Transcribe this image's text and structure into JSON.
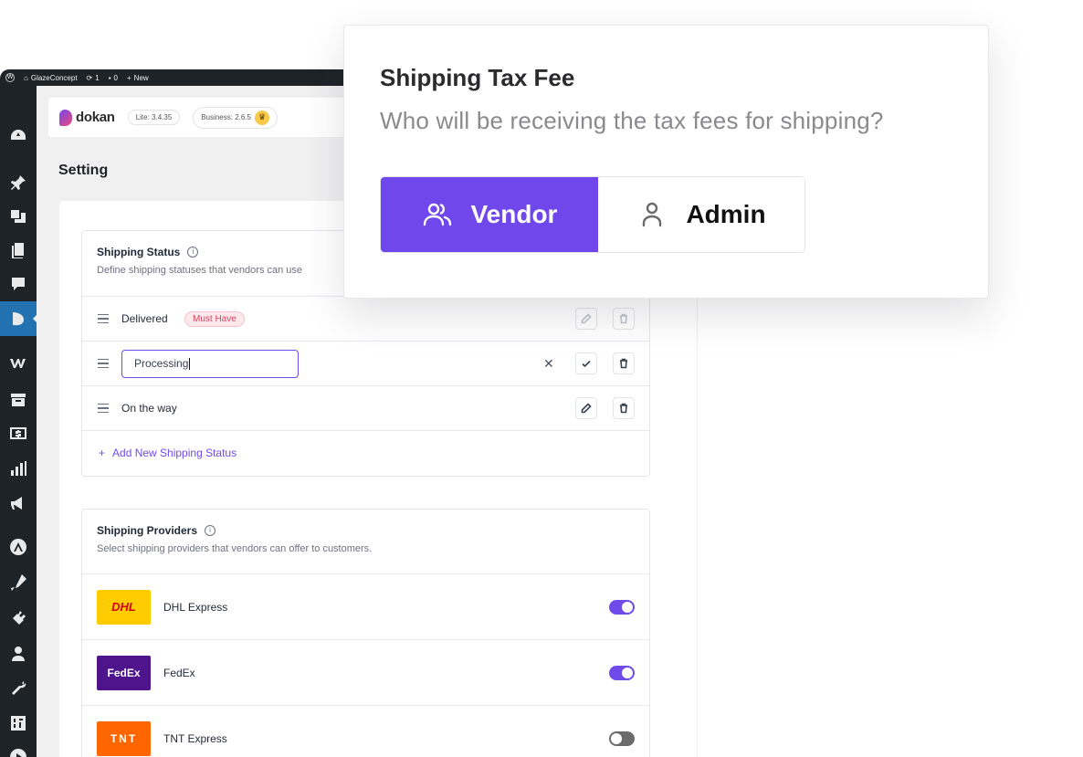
{
  "adminbar": {
    "site_name": "GlazeConcept",
    "updates_count": "1",
    "comments_count": "0",
    "new_label": "New"
  },
  "brand": {
    "name": "dokan",
    "lite_version": "Lite: 3.4.35",
    "business_version": "Business: 2.6.5"
  },
  "page": {
    "title": "Setting"
  },
  "shipping_status": {
    "title": "Shipping Status",
    "description": "Define shipping statuses that vendors can use",
    "items": [
      {
        "label": "Delivered",
        "badge": "Must Have"
      },
      {
        "label": "Processing",
        "editing": true
      },
      {
        "label": "On the way"
      }
    ],
    "add_label": "Add New Shipping Status"
  },
  "shipping_providers": {
    "title": "Shipping Providers",
    "description": "Select shipping providers that vendors can offer to customers.",
    "items": [
      {
        "name": "DHL Express",
        "logo_text": "DHL",
        "logo_bg": "#ffcc00",
        "logo_color": "#d40511",
        "enabled": true
      },
      {
        "name": "FedEx",
        "logo_text": "FedEx",
        "logo_bg": "#4d148c",
        "logo_color": "#ffffff",
        "enabled": true
      },
      {
        "name": "TNT Express",
        "logo_text": "TNT",
        "logo_bg": "#ff6600",
        "logo_color": "#ffffff",
        "enabled": false
      }
    ]
  },
  "popup": {
    "title": "Shipping Tax Fee",
    "subtitle": "Who will be receiving the tax fees for shipping?",
    "options": [
      {
        "label": "Vendor",
        "icon": "users-icon",
        "selected": true
      },
      {
        "label": "Admin",
        "icon": "user-icon",
        "selected": false
      }
    ]
  },
  "colors": {
    "accent": "#7047eb",
    "sidebar": "#1d2327",
    "sidebar_active": "#2271b1",
    "badge_text": "#d6455d"
  }
}
